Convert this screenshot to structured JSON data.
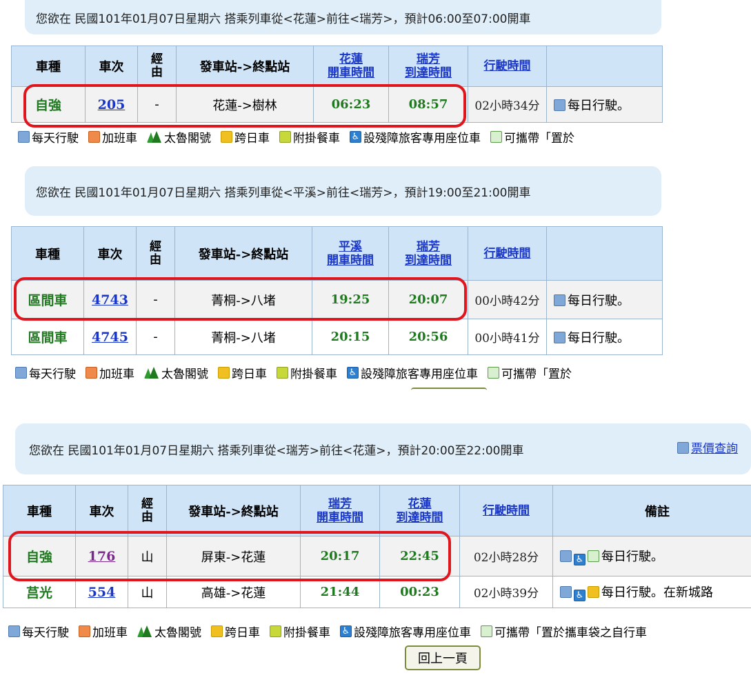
{
  "sections": [
    {
      "query": "您欲在 民國101年01月07日星期六 搭乘列車從<花蓮>前往<瑞芳>，預計06:00至07:00開車",
      "headers": {
        "type": "車種",
        "no": "車次",
        "via": "經由",
        "route": "發車站->終點站",
        "dep_station": "花蓮",
        "dep": "開車時間",
        "arr_station": "瑞芳",
        "arr": "到達時間",
        "duration": "行駛時間",
        "note": ""
      },
      "rows": [
        {
          "type": "自強",
          "no": "205",
          "via": "-",
          "route": "花蓮->樹林",
          "dep": "06:23",
          "arr": "08:57",
          "duration": "02小時34分",
          "note": "每日行駛。"
        }
      ]
    },
    {
      "query": "您欲在 民國101年01月07日星期六 搭乘列車從<平溪>前往<瑞芳>，預計19:00至21:00開車",
      "headers": {
        "type": "車種",
        "no": "車次",
        "via": "經由",
        "route": "發車站->終點站",
        "dep_station": "平溪",
        "dep": "開車時間",
        "arr_station": "瑞芳",
        "arr": "到達時間",
        "duration": "行駛時間",
        "note": ""
      },
      "rows": [
        {
          "type": "區間車",
          "no": "4743",
          "via": "-",
          "route": "菁桐->八堵",
          "dep": "19:25",
          "arr": "20:07",
          "duration": "00小時42分",
          "note": "每日行駛。"
        },
        {
          "type": "區間車",
          "no": "4745",
          "via": "-",
          "route": "菁桐->八堵",
          "dep": "20:15",
          "arr": "20:56",
          "duration": "00小時41分",
          "note": "每日行駛。"
        }
      ]
    },
    {
      "query": "您欲在 民國101年01月07日星期六 搭乘列車從<瑞芳>前往<花蓮>，預計20:00至22:00開車",
      "ticket_link": "票價查詢",
      "headers": {
        "type": "車種",
        "no": "車次",
        "via": "經由",
        "route": "發車站->終點站",
        "dep_station": "瑞芳",
        "dep": "開車時間",
        "arr_station": "花蓮",
        "arr": "到達時間",
        "duration": "行駛時間",
        "note": "備註"
      },
      "rows": [
        {
          "type": "自強",
          "no": "176",
          "via": "山",
          "route": "屏東->花蓮",
          "dep": "20:17",
          "arr": "22:45",
          "duration": "02小時28分",
          "note": "每日行駛。"
        },
        {
          "type": "莒光",
          "no": "554",
          "via": "山",
          "route": "高雄->花蓮",
          "dep": "21:44",
          "arr": "00:23",
          "duration": "02小時39分",
          "note": "每日行駛。在新城路"
        }
      ]
    }
  ],
  "legend": {
    "daily": "每天行駛",
    "extra": "加班車",
    "taroko": "太魯閣號",
    "overnight": "跨日車",
    "dining": "附掛餐車",
    "accessible": "設殘障旅客專用座位車",
    "bike_short": "可攜帶「置於",
    "bike_long": "可攜帶「置於攜車袋之自行車"
  },
  "back_button": "回上一頁",
  "colors": {
    "header_bg": "#cfe5f7",
    "query_bg": "#dfeef8",
    "highlight": "#e0161e",
    "train_type": "#1f7a1f",
    "link": "#1a36c7"
  }
}
